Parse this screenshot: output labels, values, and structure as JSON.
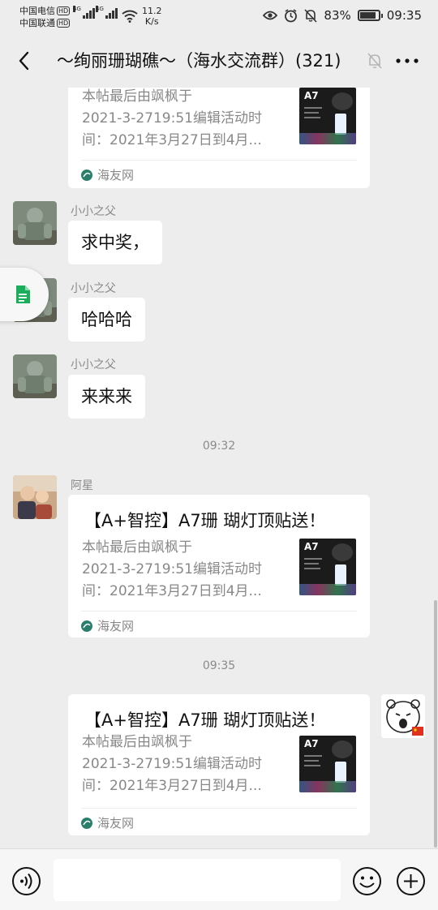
{
  "status_bar": {
    "carrier_1": "中国电信",
    "carrier_2": "中国联通",
    "hd_label": "HD",
    "net_1": "4G",
    "net_2": "4G",
    "speed_value": "11.2",
    "speed_unit": "K/s",
    "battery": "83%",
    "time": "09:35"
  },
  "header": {
    "title": "～绚丽珊瑚礁～（海水交流群）(321)"
  },
  "card_common": {
    "title": "【A+智控】A7珊 瑚灯顶贴送！",
    "desc_line_1": "本帖最后由飒枫于",
    "desc_line_2": "2021-3-2719:51编辑活动时",
    "desc_line_3": "间：2021年3月27日到4月...",
    "source": "海友网",
    "thumb_label": "A7"
  },
  "messages": {
    "m1": {
      "sender": "小小之父",
      "text": "求中奖，"
    },
    "m2": {
      "sender": "小小之父",
      "text": "哈哈哈"
    },
    "m3": {
      "sender": "小小之父",
      "text": "来来来"
    },
    "time_1": "09:32",
    "m4": {
      "sender": "阿星"
    },
    "time_2": "09:35"
  },
  "icons": {
    "back": "chevron-left-icon",
    "mute": "bell-off-icon",
    "more": "more-dots-icon",
    "voice": "voice-icon",
    "emoji": "emoji-icon",
    "plus": "plus-icon",
    "doc": "document-icon"
  },
  "colors": {
    "background": "#ededed",
    "bubble": "#ffffff",
    "meta_text": "#8a8a8a",
    "source_icon": "#2a7f6c",
    "doc_icon": "#1aad5b"
  }
}
